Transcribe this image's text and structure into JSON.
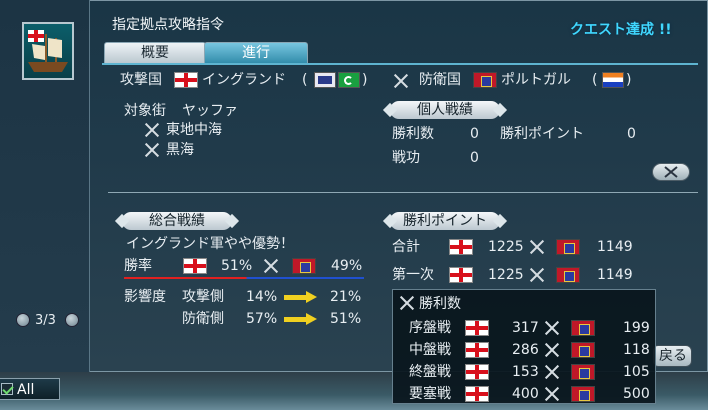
{
  "window": {
    "title": "指定拠点攻略指令",
    "quest_status": "クエスト達成 !!",
    "tabs": [
      {
        "label": "概要",
        "active": false
      },
      {
        "label": "進行",
        "active": true
      }
    ]
  },
  "sides": {
    "attacker_label": "攻撃国",
    "attacker_name": "イングランド",
    "attacker_paren_open": "(",
    "attacker_paren_close": ")",
    "defender_label": "防衛国",
    "defender_name": "ポルトガル",
    "defender_paren_open": "(",
    "defender_paren_close": ")"
  },
  "targets": {
    "label": "対象街",
    "city": "ヤッファ",
    "seas": [
      "東地中海",
      "黒海"
    ]
  },
  "personal": {
    "header": "個人戦績",
    "wins_label": "勝利数",
    "wins_value": "0",
    "points_label": "勝利ポイント",
    "points_value": "0",
    "merit_label": "戦功",
    "merit_value": "0"
  },
  "overall": {
    "header": "総合戦績",
    "status": "イングランド軍やや優勢！",
    "winrate_label": "勝率",
    "attacker_rate": "51%",
    "defender_rate": "49%",
    "influence_label": "影響度",
    "attack_side_label": "攻撃側",
    "attack_from": "14%",
    "attack_to": "21%",
    "defense_side_label": "防衛側",
    "defense_from": "57%",
    "defense_to": "51%"
  },
  "victory_points": {
    "header": "勝利ポイント",
    "rows": [
      {
        "label": "合計",
        "attacker": "1225",
        "defender": "1149"
      },
      {
        "label": "第一次",
        "attacker": "1225",
        "defender": "1149"
      }
    ]
  },
  "win_count_popup": {
    "header": "勝利数",
    "rows": [
      {
        "label": "序盤戦",
        "attacker": "317",
        "defender": "199"
      },
      {
        "label": "中盤戦",
        "attacker": "286",
        "defender": "118"
      },
      {
        "label": "終盤戦",
        "attacker": "153",
        "defender": "105"
      },
      {
        "label": "要塞戦",
        "attacker": "400",
        "defender": "500"
      }
    ]
  },
  "pager": {
    "text": "3/3"
  },
  "buttons": {
    "back_label": "戻る"
  },
  "filter": {
    "label": "All"
  },
  "colors": {
    "quest": "#40d8ff",
    "tab_active": "#2f8aa8",
    "arrow": "#f0d020",
    "england_red": "#d8101c",
    "portugal_red": "#c01828"
  }
}
